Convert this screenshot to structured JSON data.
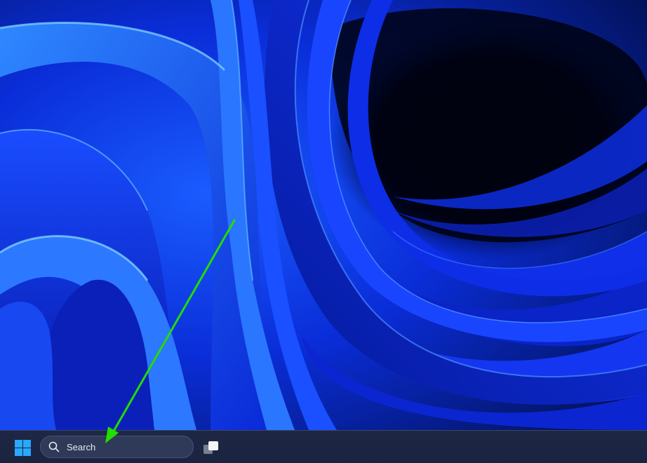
{
  "desktop": {
    "wallpaper_name": "windows-11-bloom-wallpaper",
    "wallpaper_colors": {
      "deep": "#000414",
      "dark": "#00106e",
      "mid": "#0a2dff",
      "bright": "#2f7bff",
      "highlight": "#5ab4ff"
    }
  },
  "annotation": {
    "type": "arrow",
    "color": "#22dd00",
    "points_to": "search-box"
  },
  "taskbar": {
    "start_icon": "windows-logo-icon",
    "start_icon_color": "#29a8ff",
    "search": {
      "icon": "search-icon",
      "placeholder": "Search"
    },
    "taskview_icon": "task-view-icon"
  }
}
